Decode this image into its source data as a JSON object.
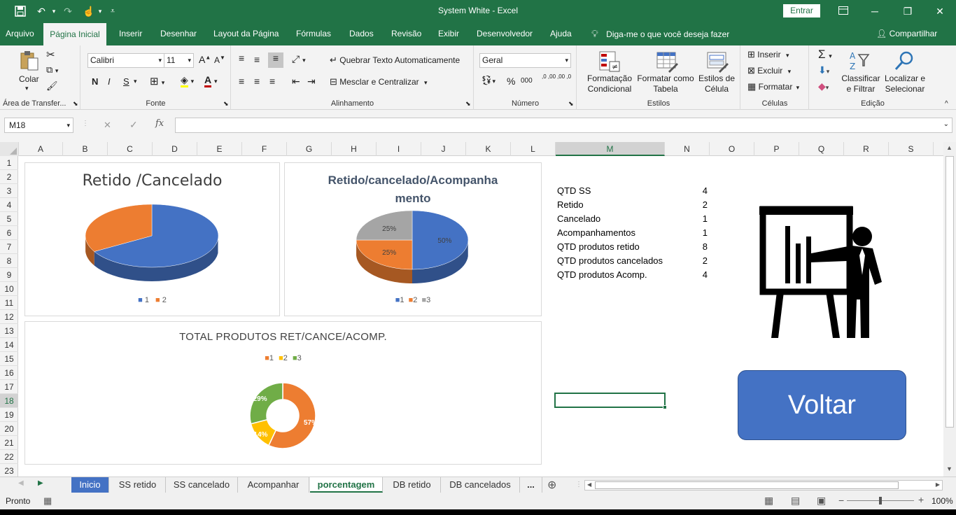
{
  "titlebar": {
    "title": "System White  -  Excel",
    "enter_label": "Entrar",
    "save_icon": "save-icon",
    "undo_icon": "undo-icon",
    "redo_icon": "redo-icon",
    "touch_icon": "touch-mode-icon",
    "customize_icon": "customize-icon",
    "ribbon_display_icon": "ribbon-display-icon",
    "minimize": "─",
    "restore": "❐",
    "close": "✕"
  },
  "tabs": {
    "items": [
      "Arquivo",
      "Página Inicial",
      "Inserir",
      "Desenhar",
      "Layout da Página",
      "Fórmulas",
      "Dados",
      "Revisão",
      "Exibir",
      "Desenvolvedor",
      "Ajuda"
    ],
    "active": "Página Inicial",
    "tell_me": "Diga-me o que você deseja fazer",
    "share": "Compartilhar"
  },
  "ribbon": {
    "clipboard": {
      "label": "Área de Transfer...",
      "paste": "Colar"
    },
    "font": {
      "label": "Fonte",
      "name": "Calibri",
      "size": "11",
      "bold": "N",
      "italic": "I",
      "underline": "S"
    },
    "alignment": {
      "label": "Alinhamento",
      "wrap": "Quebrar Texto Automaticamente",
      "merge": "Mesclar e Centralizar"
    },
    "number": {
      "label": "Número",
      "format": "Geral",
      "percent": "%",
      "thousands": "000",
      "inc_dec": ",0 ,00",
      "dec_dec": ",00 ,0"
    },
    "styles": {
      "label": "Estilos",
      "conditional": "Formatação Condicional",
      "as_table": "Formatar como Tabela",
      "cell_styles": "Estilos de Célula"
    },
    "cells": {
      "label": "Células",
      "insert": "Inserir",
      "delete": "Excluir",
      "format": "Formatar"
    },
    "editing": {
      "label": "Edição",
      "sort": "Classificar e Filtrar",
      "find": "Localizar e Selecionar"
    }
  },
  "formula_bar": {
    "name_box": "M18",
    "fx": "fx",
    "cancel": "✕",
    "confirm": "✓",
    "content": ""
  },
  "columns": [
    "A",
    "B",
    "C",
    "D",
    "E",
    "F",
    "G",
    "H",
    "I",
    "J",
    "K",
    "L",
    "M",
    "N",
    "O",
    "P",
    "Q",
    "R",
    "S"
  ],
  "rows": [
    "1",
    "2",
    "3",
    "4",
    "5",
    "6",
    "7",
    "8",
    "9",
    "10",
    "11",
    "12",
    "13",
    "14",
    "15",
    "16",
    "17",
    "18",
    "19",
    "20",
    "21",
    "22",
    "23"
  ],
  "selected_cell": {
    "column": "M",
    "row": "18"
  },
  "summary_table": [
    {
      "label": "QTD SS",
      "value": "4"
    },
    {
      "label": "Retido",
      "value": "2"
    },
    {
      "label": "Cancelado",
      "value": "1"
    },
    {
      "label": "Acompanhamentos",
      "value": "1"
    },
    {
      "label": "QTD produtos retido",
      "value": "8"
    },
    {
      "label": "QTD produtos cancelados",
      "value": "2"
    },
    {
      "label": "QTD produtos Acomp.",
      "value": "4"
    }
  ],
  "voltar_button": "Voltar",
  "presenter_icon": "presenter-icon",
  "charts": [
    {
      "type": "pie",
      "title": "Retido /Cancelado",
      "categories": [
        "1",
        "2"
      ],
      "values": [
        2,
        1
      ],
      "colors": [
        "#4472c4",
        "#ed7d31"
      ],
      "data_labels": [
        "",
        ""
      ],
      "legend_position": "bottom"
    },
    {
      "type": "pie",
      "title": "Retido/cancelado/Acompanhamento",
      "title_lines": [
        "Retido/cancelado/Acompanha",
        "mento"
      ],
      "categories": [
        "1",
        "2",
        "3"
      ],
      "values": [
        50,
        25,
        25
      ],
      "colors": [
        "#4472c4",
        "#ed7d31",
        "#a5a5a5"
      ],
      "data_labels": [
        "50%",
        "25%",
        "25%"
      ],
      "legend_position": "bottom"
    },
    {
      "type": "pie",
      "title": "TOTAL PRODUTOS RET/CANCE/ACOMP.",
      "categories": [
        "1",
        "2",
        "3"
      ],
      "values": [
        57,
        14,
        29
      ],
      "colors": [
        "#ed7d31",
        "#ffc000",
        "#70ad47"
      ],
      "data_labels": [
        "57%",
        "14%",
        "29%"
      ],
      "legend_position": "top"
    }
  ],
  "chart_data": [
    {
      "type": "pie",
      "title": "Retido /Cancelado",
      "categories": [
        "1",
        "2"
      ],
      "values": [
        2,
        1
      ]
    },
    {
      "type": "pie",
      "title": "Retido/cancelado/Acompanhamento",
      "categories": [
        "1",
        "2",
        "3"
      ],
      "values": [
        50,
        25,
        25
      ]
    },
    {
      "type": "pie",
      "title": "TOTAL PRODUTOS RET/CANCE/ACOMP.",
      "categories": [
        "1",
        "2",
        "3"
      ],
      "values": [
        57,
        14,
        29
      ]
    }
  ],
  "sheet_tabs": {
    "items": [
      "Inicio",
      "SS retido",
      "SS cancelado",
      "Acompanhar",
      "porcentagem",
      "DB retido",
      "DB cancelados"
    ],
    "active": "porcentagem",
    "highlighted": "Inicio",
    "more": "...",
    "add": "⊕"
  },
  "status": {
    "ready": "Pronto",
    "zoom": "100%",
    "minus": "−",
    "plus": "+"
  }
}
